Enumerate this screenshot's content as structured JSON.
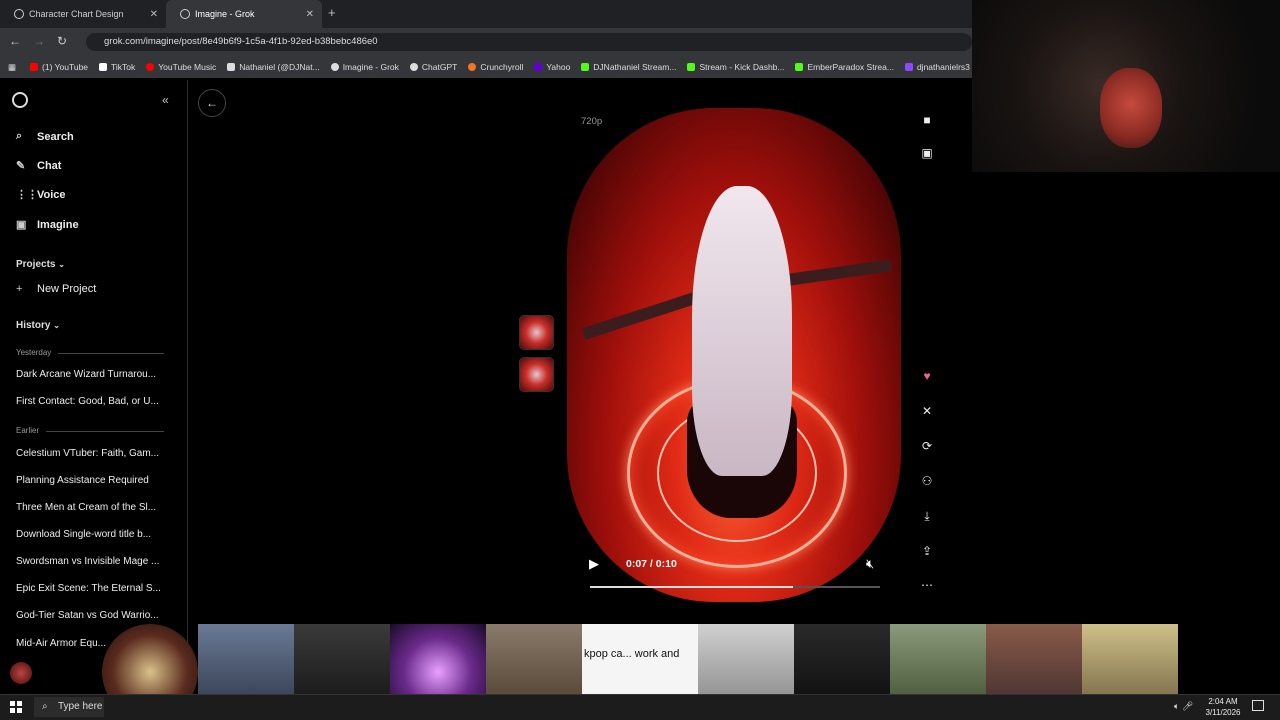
{
  "browser": {
    "tabs": [
      {
        "title": "Character Chart Design"
      },
      {
        "title": "Imagine - Grok"
      }
    ],
    "url": "grok.com/imagine/post/8e49b6f9-1c5a-4f1b-92ed-b38bebc486e0",
    "bookmarks": [
      {
        "label": "(1) YouTube",
        "color": "#ff0000"
      },
      {
        "label": "TikTok",
        "color": "#ffffff"
      },
      {
        "label": "YouTube Music",
        "color": "#ff0000"
      },
      {
        "label": "Nathaniel (@DJNat...",
        "color": "#ffffff"
      },
      {
        "label": "Imagine - Grok",
        "color": "#ffffff"
      },
      {
        "label": "ChatGPT",
        "color": "#ffffff"
      },
      {
        "label": "Crunchyroll",
        "color": "#f47521"
      },
      {
        "label": "Yahoo",
        "color": "#6001d2"
      },
      {
        "label": "DJNathaniel Stream...",
        "color": "#53fc18"
      },
      {
        "label": "Stream - Kick Dashb...",
        "color": "#53fc18"
      },
      {
        "label": "EmberParadox Strea...",
        "color": "#53fc18"
      },
      {
        "label": "djnathanielrs3 - Tw",
        "color": "#9146ff"
      }
    ]
  },
  "sidebar": {
    "nav": [
      {
        "label": "Search",
        "icon": "search-icon"
      },
      {
        "label": "Chat",
        "icon": "chat-icon"
      },
      {
        "label": "Voice",
        "icon": "voice-icon"
      },
      {
        "label": "Imagine",
        "icon": "imagine-icon"
      }
    ],
    "projects_label": "Projects",
    "new_project": "New Project",
    "history_label": "History",
    "yesterday_label": "Yesterday",
    "earlier_label": "Earlier",
    "history_yesterday": [
      "Dark Arcane Wizard Turnarou...",
      "First Contact: Good, Bad, or U..."
    ],
    "history_earlier": [
      "Celestium VTuber: Faith, Gam...",
      "Planning Assistance Required",
      "Three Men at Cream of the Sl...",
      "Download Single-word title b...",
      "Swordsman vs Invisible Mage ...",
      "Epic Exit Scene: The Eternal S...",
      "God-Tier Satan vs God Warrio...",
      "Mid-Air Armor Equ..."
    ]
  },
  "player": {
    "quality": "720p",
    "time": "0:07 / 0:10",
    "progress": 0.7,
    "accent": "#ff3b2a"
  },
  "strip": {
    "overlay_text": "kpop ca... work and",
    "tile_colors": [
      "#3b2a1f",
      "#4a5a75",
      "#2a2a2a",
      "#6a2a8a",
      "#6a5a4a",
      "#ffffff",
      "#b0b0b0",
      "#3a3a3a",
      "#7a8a6a",
      "#8a2a2a",
      "#c8b48a"
    ]
  },
  "taskbar": {
    "search_placeholder": "Type here",
    "time": "2:04 AM",
    "date": "3/11/2026"
  }
}
